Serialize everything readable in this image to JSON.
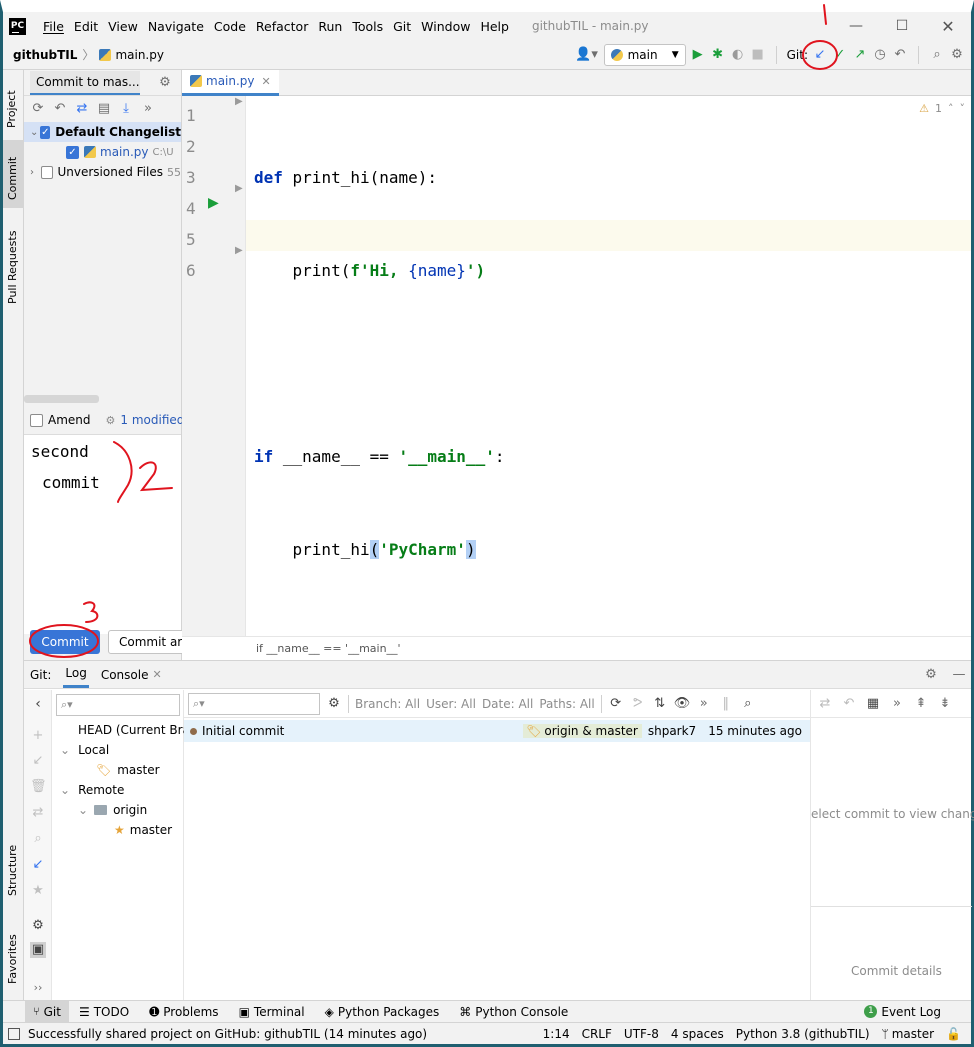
{
  "menubar": {
    "items": [
      "File",
      "Edit",
      "View",
      "Navigate",
      "Code",
      "Refactor",
      "Run",
      "Tools",
      "Git",
      "Window",
      "Help"
    ],
    "title": "githubTIL - main.py"
  },
  "navbar": {
    "project": "githubTIL",
    "file": "main.py",
    "run_config": "main",
    "git_label": "Git:"
  },
  "side_tools": {
    "left_top": [
      "Project",
      "Commit",
      "Pull Requests"
    ],
    "left_bottom": [
      "Structure",
      "Favorites"
    ]
  },
  "commit_panel": {
    "tab_label": "Commit to mas...",
    "changelist_label": "Default Changelist",
    "file_name": "main.py",
    "file_path": "C:\\U",
    "unversioned_label": "Unversioned Files",
    "unversioned_count": "55",
    "amend_label": "Amend",
    "modified_label": "1 modified",
    "message_line1": "second",
    "message_line2": "commit",
    "commit_button": "Commit",
    "commit_and_push_button": "Commit ar"
  },
  "editor": {
    "tab": "main.py",
    "warning_count": "1",
    "line_numbers": [
      "1",
      "2",
      "3",
      "4",
      "5",
      "6"
    ],
    "breadcrumb": "if __name__ == '__main__'",
    "code": {
      "l1_kw": "def",
      "l1_rest": " print_hi(name):",
      "l2_pre": "    print(",
      "l2_str": "f'Hi, ",
      "l2_brace": "{name}",
      "l2_end": "')",
      "l4_kw": "if",
      "l4_mid": " __name__ == ",
      "l4_str": "'__main__'",
      "l4_end": ":",
      "l5_pre": "    print_hi",
      "l5_open": "(",
      "l5_str": "'PyCharm'",
      "l5_close": ")"
    }
  },
  "git_panel": {
    "label": "Git:",
    "tabs": [
      "Log",
      "Console"
    ],
    "filters": {
      "branch": "Branch: All",
      "user": "User: All",
      "date": "Date: All",
      "paths": "Paths: All"
    },
    "tree": {
      "head": "HEAD (Current Bran",
      "local": "Local",
      "local_master": "master",
      "remote": "Remote",
      "origin": "origin",
      "origin_master": "master"
    },
    "commit_row": {
      "message": "Initial commit",
      "refs": "origin & master",
      "author": "shpark7",
      "time": "15 minutes ago"
    },
    "details_placeholder": "elect commit to view change",
    "commit_details": "Commit details"
  },
  "bottom_tabs": [
    "Git",
    "TODO",
    "Problems",
    "Terminal",
    "Python Packages",
    "Python Console"
  ],
  "event_log": {
    "count": "1",
    "label": "Event Log"
  },
  "statusbar": {
    "message": "Successfully shared project on GitHub: githubTIL (14 minutes ago)",
    "position": "1:14",
    "line_sep": "CRLF",
    "encoding": "UTF-8",
    "indent": "4 spaces",
    "interpreter": "Python 3.8 (githubTIL)",
    "branch": "master"
  },
  "annotations": [
    "1",
    "2",
    "3"
  ],
  "colors": {
    "accent": "#3574f0",
    "commit_button": "#3875d7",
    "selection": "#d5e1f5",
    "highlight_line": "#fcfaed",
    "annotation": "#e0141e"
  }
}
